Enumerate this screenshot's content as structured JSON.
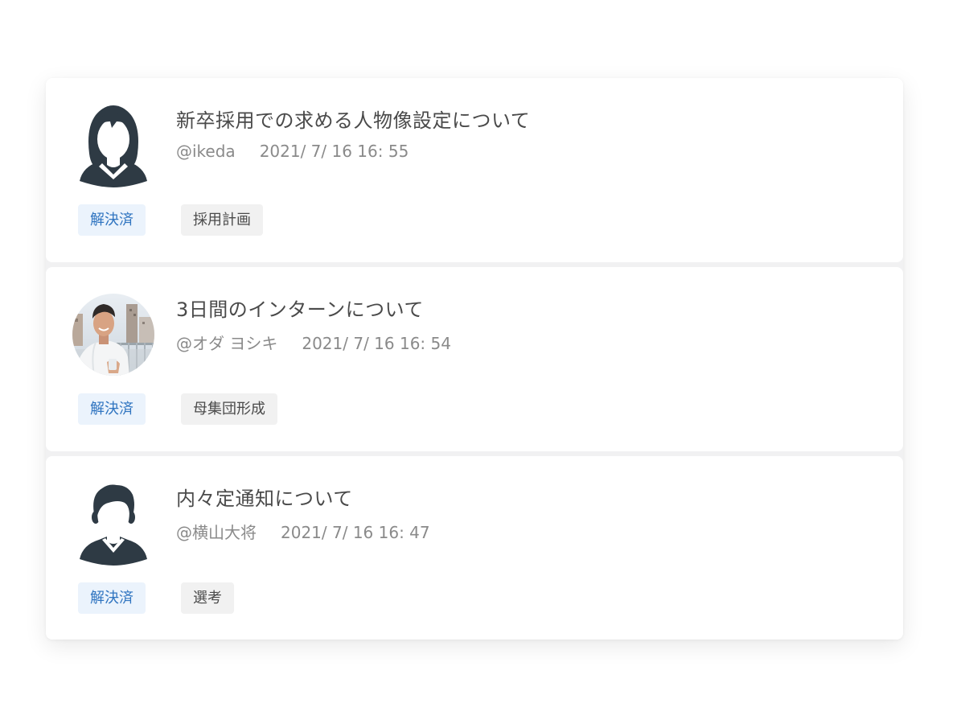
{
  "posts": [
    {
      "title": "新卒採用での求める人物像設定について",
      "author": "@ikeda",
      "datetime": "2021/ 7/ 16 16: 55",
      "status": "解決済",
      "tag": "採用計画",
      "avatar": "female-silhouette-icon"
    },
    {
      "title": "3日間のインターンについて",
      "author": "@オダ ヨシキ",
      "datetime": "2021/ 7/ 16 16: 54",
      "status": "解決済",
      "tag": "母集団形成",
      "avatar": "user-photo"
    },
    {
      "title": "内々定通知について",
      "author": "@横山大将",
      "datetime": "2021/ 7/ 16 16: 47",
      "status": "解決済",
      "tag": "選考",
      "avatar": "male-silhouette-icon"
    }
  ],
  "colors": {
    "status_bg": "#ebf3fc",
    "status_text": "#2f74c0",
    "tag_bg": "#f1f1f1",
    "silhouette": "#2e3a44"
  }
}
